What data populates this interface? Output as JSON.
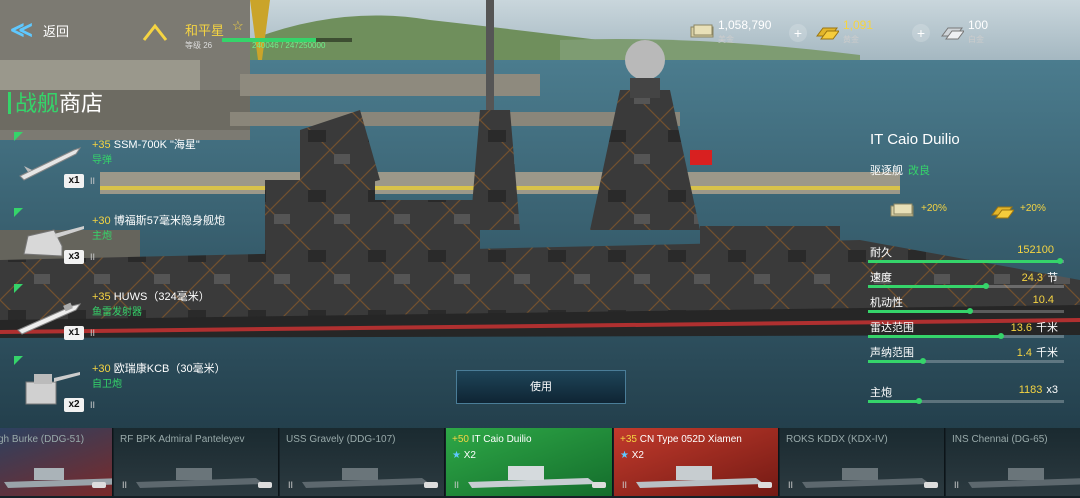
{
  "topbar": {
    "back_label": "返回",
    "player_name": "和平星",
    "player_level": "等级 26",
    "xp_text": "240046 / 247250000",
    "xp_fraction": 0.72,
    "currencies": [
      {
        "icon": "cash-icon",
        "value": "1,058,790",
        "label": "美金",
        "color": "#ffffff"
      },
      {
        "icon": "gold-icon",
        "value": "1,091",
        "label": "黄金",
        "color": "#f5d442"
      },
      {
        "icon": "platinum-icon",
        "value": "100",
        "label": "白金",
        "color": "#ffffff"
      }
    ]
  },
  "shop": {
    "title_a": "战舰",
    "title_b": "商店"
  },
  "weapons": [
    {
      "level": "+35",
      "name": "SSM-700K \"海星\"",
      "category": "导弹",
      "qty": "x1",
      "icon": "missile-icon"
    },
    {
      "level": "+30",
      "name": "博福斯57毫米隐身舰炮",
      "category": "主炮",
      "qty": "x3",
      "icon": "turret-icon"
    },
    {
      "level": "+35",
      "name": "HUWS（324毫米）",
      "category": "鱼雷发射器",
      "qty": "x1",
      "icon": "torpedo-icon"
    },
    {
      "level": "+30",
      "name": "欧瑞康KCB（30毫米）",
      "category": "自卫炮",
      "qty": "x2",
      "icon": "cannon-icon"
    }
  ],
  "use_button": "使用",
  "ship": {
    "name": "IT Caio Duilio",
    "type": "驱逐舰",
    "upgrade": "改良",
    "bonuses": [
      {
        "icon": "cash-icon",
        "value": "+20%"
      },
      {
        "icon": "gold-icon",
        "value": "+20%"
      }
    ],
    "stats": [
      {
        "key": "耐久",
        "value": "152100",
        "unit": "",
        "fraction": 0.98
      },
      {
        "key": "速度",
        "value": "24.3",
        "unit": "节",
        "fraction": 0.6
      },
      {
        "key": "机动性",
        "value": "10.4",
        "unit": "",
        "fraction": 0.52
      },
      {
        "key": "雷达范围",
        "value": "13.6",
        "unit": "千米",
        "fraction": 0.68
      },
      {
        "key": "声纳范围",
        "value": "1.4",
        "unit": "千米",
        "fraction": 0.28
      },
      {
        "key": "主炮",
        "value": "1183",
        "unit": "x3",
        "fraction": 0.26
      }
    ]
  },
  "ships": [
    {
      "name": "gh Burke (DDG-51)",
      "level": "",
      "mult": "",
      "style": "flag"
    },
    {
      "name": "RF BPK Admiral Panteleyev",
      "level": "",
      "mult": "",
      "style": "dark"
    },
    {
      "name": "USS Gravely (DDG-107)",
      "level": "",
      "mult": "",
      "style": "dark"
    },
    {
      "name": "IT Caio Duilio",
      "level": "+50",
      "mult": "X2",
      "style": "sel"
    },
    {
      "name": "CN Type 052D Xiamen",
      "level": "+35",
      "mult": "X2",
      "style": "red"
    },
    {
      "name": "ROKS KDDX (KDX-IV)",
      "level": "",
      "mult": "",
      "style": "dark"
    },
    {
      "name": "INS Chennai (DG-65)",
      "level": "",
      "mult": "",
      "style": "dark"
    }
  ],
  "colors": {
    "accent": "#35d46a",
    "gold": "#f5d442",
    "info": "#5fc8ff"
  }
}
